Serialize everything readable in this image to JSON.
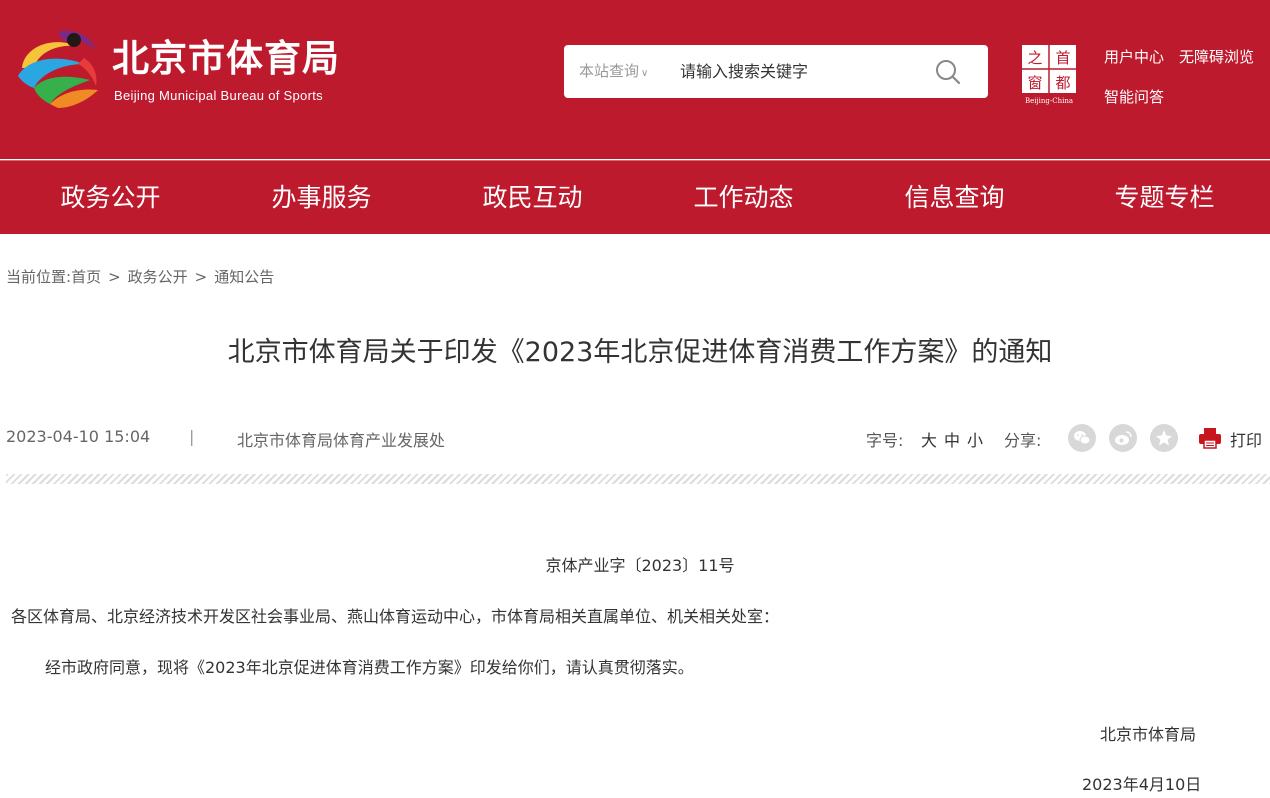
{
  "site": {
    "name_cn": "北京市体育局",
    "name_en": "Beijing Municipal Bureau of Sports",
    "seal_text": [
      "首",
      "都",
      "之",
      "窗"
    ],
    "seal_caption": "Beijing-China"
  },
  "search": {
    "scope": "本站查询",
    "placeholder": "请输入搜索关键字"
  },
  "toplinks": {
    "user_center": "用户中心",
    "accessibility": "无障碍浏览",
    "smart_qa": "智能问答"
  },
  "nav": {
    "items": [
      "政务公开",
      "办事服务",
      "政民互动",
      "工作动态",
      "信息查询",
      "专题专栏"
    ]
  },
  "breadcrumb": {
    "prefix": "当前位置:",
    "items": [
      "首页",
      "政务公开",
      "通知公告"
    ],
    "separator": ">"
  },
  "article": {
    "title": "北京市体育局关于印发《2023年北京促进体育消费工作方案》的通知",
    "date": "2023-04-10 15:04",
    "separator": "|",
    "source": "北京市体育局体育产业发展处",
    "font_size_label": "字号:",
    "font_sizes": [
      "大",
      "中",
      "小"
    ],
    "share_label": "分享:",
    "share_targets": [
      "wechat-icon",
      "weibo-icon",
      "qzone-icon"
    ],
    "print_label": "打印",
    "doc_number": "京体产业字〔2023〕11号",
    "recipients": "各区体育局、北京经济技术开发区社会事业局、燕山体育运动中心，市体育局相关直属单位、机关相关处室：",
    "body": "经市政府同意，现将《2023年北京促进体育消费工作方案》印发给你们，请认真贯彻落实。",
    "signature": "北京市体育局",
    "sign_date": "2023年4月10日"
  },
  "colors": {
    "brand_red": "#bd1a2d",
    "text": "#333333",
    "muted": "#666666"
  }
}
